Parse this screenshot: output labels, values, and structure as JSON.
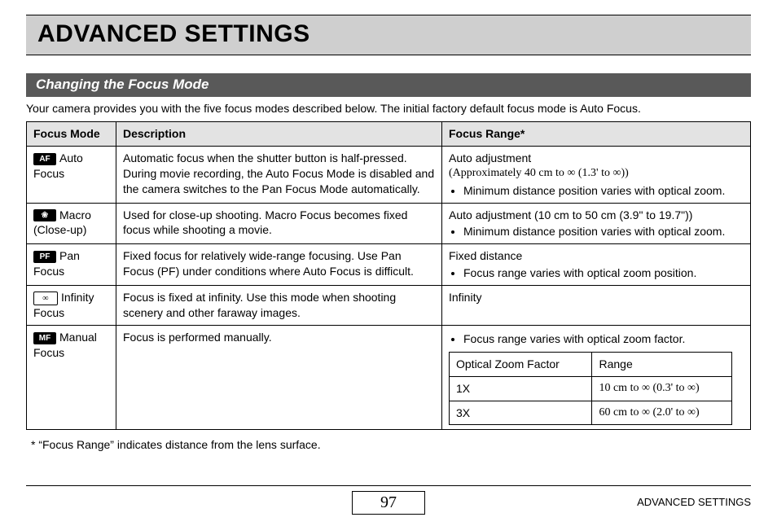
{
  "title": "ADVANCED SETTINGS",
  "section": "Changing the Focus Mode",
  "intro": "Your camera provides you with the five focus modes described below. The initial factory default focus mode is Auto Focus.",
  "headers": {
    "col1": "Focus Mode",
    "col2": "Description",
    "col3": "Focus Range*"
  },
  "rows": {
    "auto": {
      "icon": "AF",
      "name": "Auto Focus",
      "desc": "Automatic focus when the shutter button is half-pressed. During movie recording, the Auto Focus Mode is disabled and the camera switches to the Pan Focus Mode automatically.",
      "range_line1": "Auto adjustment",
      "range_line2": "(Approximately 40 cm to ∞ (1.3' to ∞))",
      "range_bullet": "Minimum distance position varies with optical zoom."
    },
    "macro": {
      "icon": "❀",
      "name": "Macro (Close-up)",
      "desc": "Used for close-up shooting. Macro Focus becomes fixed focus while shooting a movie.",
      "range_line1": "Auto adjustment (10 cm to 50 cm (3.9\" to 19.7\"))",
      "range_bullet": "Minimum distance position varies with optical zoom."
    },
    "pan": {
      "icon": "PF",
      "name": "Pan Focus",
      "desc": "Fixed focus for relatively wide-range focusing. Use Pan Focus (PF) under conditions where Auto Focus is difficult.",
      "range_line1": "Fixed distance",
      "range_bullet": "Focus range varies with optical zoom position."
    },
    "infinity": {
      "icon": "∞",
      "name": "Infinity Focus",
      "desc": "Focus is fixed at infinity. Use this mode when shooting scenery and other faraway images.",
      "range_line1": "Infinity"
    },
    "manual": {
      "icon": "MF",
      "name": "Manual Focus",
      "desc": "Focus is performed manually.",
      "range_bullet": "Focus range varies with optical zoom factor.",
      "sub_headers": {
        "c1": "Optical Zoom Factor",
        "c2": "Range"
      },
      "sub_rows": {
        "r1": {
          "c1": "1X",
          "c2": "10 cm to ∞ (0.3' to ∞)"
        },
        "r2": {
          "c1": "3X",
          "c2": "60 cm to ∞ (2.0' to ∞)"
        }
      }
    }
  },
  "footnote": "*  “Focus Range” indicates distance from the lens surface.",
  "footer_label": "ADVANCED SETTINGS",
  "page_number": "97"
}
